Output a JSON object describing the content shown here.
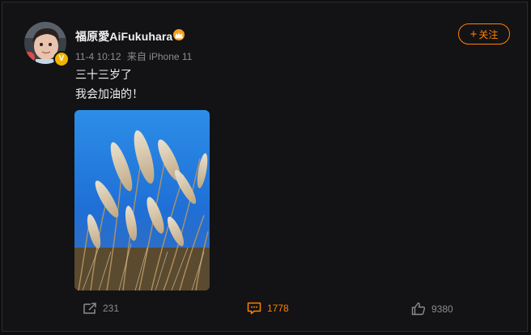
{
  "post": {
    "author": {
      "name": "福原愛AiFukuhara",
      "verified_icon": "verified-v-icon",
      "crown_icon": "member-crown-icon"
    },
    "meta": {
      "time": "11-4 10:12",
      "source": "来自 iPhone 11"
    },
    "follow_label": "关注",
    "text": {
      "line1": "三十三岁了",
      "line2": "我会加油的！"
    },
    "image": {
      "subject": "pampas-grass-photo"
    },
    "actions": {
      "repost_count": "231",
      "comment_count": "1778",
      "like_count": "9380"
    }
  },
  "colors": {
    "background": "#131214",
    "accent": "#ff8200",
    "verified": "#f0b400",
    "muted": "#8d8b90"
  }
}
